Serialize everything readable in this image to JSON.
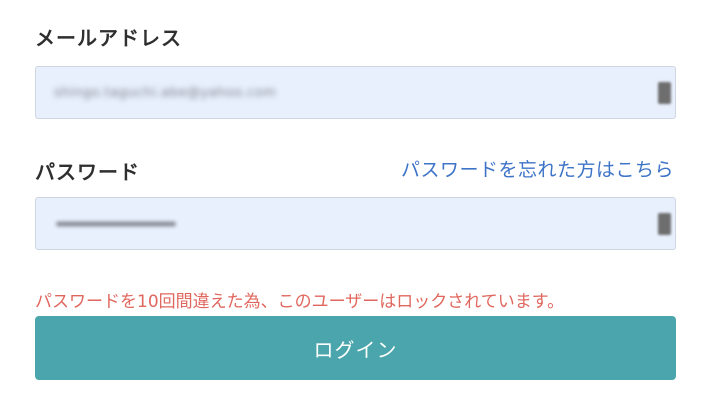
{
  "form": {
    "email": {
      "label": "メールアドレス",
      "value": "shingo.taguchi.abe@yahoo.com"
    },
    "password": {
      "label": "パスワード",
      "value": "••••••••••",
      "forgot_link": "パスワードを忘れた方はこちら"
    },
    "error_message": "パスワードを10回間違えた為、このユーザーはロックされています。",
    "login_button": "ログイン"
  },
  "icons": {
    "autofill": "autofill-key-icon"
  },
  "colors": {
    "label": "#2f2f2f",
    "link": "#3d74c7",
    "field_background": "#e8f0fd",
    "error": "#e0675e",
    "button": "#4aa6ac"
  }
}
